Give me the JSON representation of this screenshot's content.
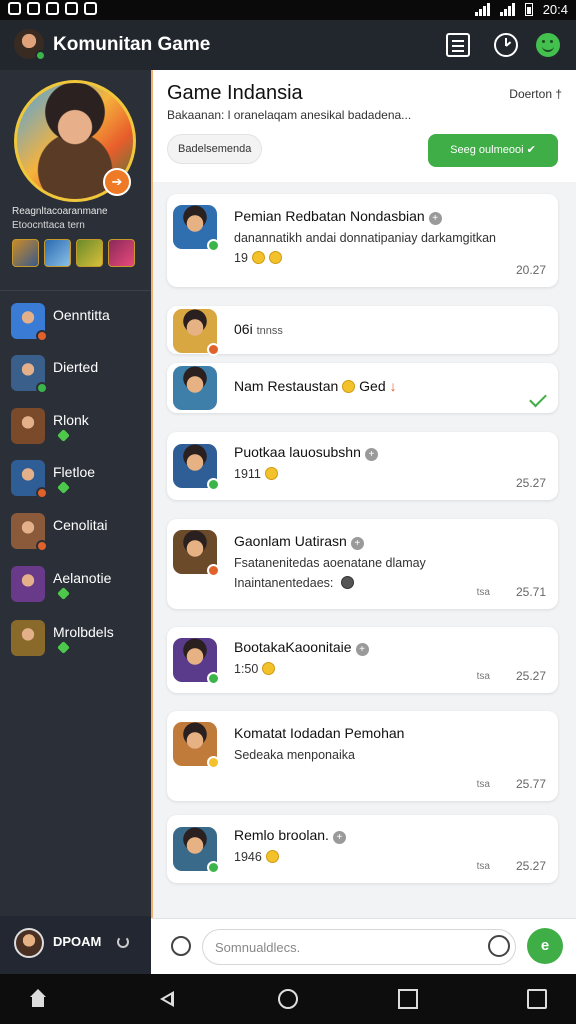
{
  "status_bar": {
    "time": "20:4"
  },
  "app_bar": {
    "title": "Komunitan Game",
    "icons": [
      "avatar",
      "news-icon",
      "clock-icon",
      "smile-icon"
    ]
  },
  "sidebar": {
    "profile_name": "Reagnltacoaranmane",
    "profile_sub": "Etoocnttaca tern",
    "badge_icon": "➔",
    "items": [
      {
        "label": "Oenntitta",
        "thumb_color": "#3a7bd5",
        "mini_color": "#e0612a",
        "gem": false
      },
      {
        "label": "Dierted",
        "thumb_color": "#3a5f8a",
        "mini_color": "#3bb54a",
        "gem": false
      },
      {
        "label": "Rlonk",
        "thumb_color": "#7a4a2a",
        "mini_color": "",
        "gem": true
      },
      {
        "label": "Fletloe",
        "thumb_color": "#2f5e96",
        "mini_color": "#e0612a",
        "gem": true
      },
      {
        "label": "Cenolitai",
        "thumb_color": "#8a5a3a",
        "mini_color": "#e0612a",
        "gem": false
      },
      {
        "label": "Aelanotie",
        "thumb_color": "#6a3a8a",
        "mini_color": "",
        "gem": true
      },
      {
        "label": "Mrolbdels",
        "thumb_color": "#8a6a2a",
        "mini_color": "",
        "gem": true
      }
    ],
    "me": {
      "name": "DPOAM"
    }
  },
  "group": {
    "title": "Game Indansia",
    "meta": "Doerton †",
    "description": "Bakaanan: l oranelaqam anesikal badadena...",
    "chip": "Badelsemenda",
    "join_label": "Seeg oulmeooi ✔"
  },
  "cards": [
    {
      "name": "Pemian Redbatan Nondasbian",
      "plus": "+",
      "msg": "danannatikh andai donnatipaniay darkamgitkan",
      "extra": "19",
      "coins": 2,
      "time": "20.27",
      "sub": "",
      "check": false,
      "pin": false,
      "ava_color": "#2f6fb0",
      "mini_color": "#3bb54a"
    },
    {
      "name": "06i",
      "plus": "",
      "msg": "",
      "extra": "",
      "coins": 0,
      "time": "",
      "sub": "",
      "check": false,
      "pin": false,
      "ava_color": "#d9a742",
      "mini_color": "#e0612a",
      "inline_note": "tnnss"
    },
    {
      "name": "Nam Restaustan",
      "plus": "",
      "msg": "",
      "extra": "",
      "coins": 1,
      "time": "",
      "sub": "",
      "check": true,
      "pin": true,
      "after": "Ged",
      "ava_color": "#3d7fa8",
      "mini_color": ""
    },
    {
      "name": "Puotkaa lauosubshn",
      "plus": "+",
      "msg": "",
      "extra": "1911",
      "coins": 1,
      "time": "25.27",
      "sub": "",
      "check": false,
      "pin": false,
      "ava_color": "#2f5e96",
      "mini_color": "#3bb54a"
    },
    {
      "name": "Gaonlam Uatirasn",
      "plus": "+",
      "msg": "Fsatanenitedas aoenatane dlamay",
      "msg2": "Inaintanentedaes:",
      "extra": "",
      "coins": 0,
      "time": "25.71",
      "sub": "tsa",
      "check": false,
      "pin": false,
      "ava_color": "#6b4a2a",
      "mini_color": "#e0612a"
    },
    {
      "name": "BootakaKaoonitaie",
      "plus": "+",
      "msg": "",
      "extra": "1:50",
      "coins": 1,
      "time": "25.27",
      "sub": "tsa",
      "check": false,
      "pin": false,
      "ava_color": "#5a3a8a",
      "mini_color": "#3bb54a"
    },
    {
      "name": "Komatat Iodadan Pemohan",
      "plus": "",
      "msg": "Sedeaka menponaika",
      "extra": "",
      "coins": 0,
      "time": "25.77",
      "sub": "tsa",
      "check": false,
      "pin": false,
      "ava_color": "#c07a3a",
      "mini_color": "#f3c22b"
    },
    {
      "name": "Remlo broolan.",
      "plus": "+",
      "msg": "",
      "extra": "1946",
      "coins": 1,
      "time": "25.27",
      "sub": "tsa",
      "check": false,
      "pin": false,
      "ava_color": "#3a6a8a",
      "mini_color": "#3bb54a"
    }
  ],
  "composer": {
    "placeholder": "Somnualdlecs."
  },
  "colors": {
    "accent": "#3fae46",
    "sidebar": "#2b3038",
    "appbar": "#22272e"
  }
}
